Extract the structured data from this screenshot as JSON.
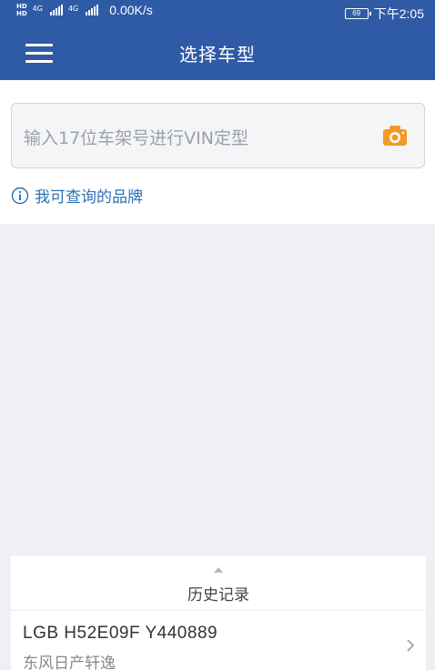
{
  "status": {
    "hd1": "HD",
    "hd2": "HD",
    "net1": "4G",
    "net2": "4G",
    "speed": "0.00K/s",
    "battery": "69",
    "time": "下午2:05"
  },
  "header": {
    "title": "选择车型",
    "menu_icon": "hamburger-menu-icon",
    "color": "#2f5aa6"
  },
  "search": {
    "placeholder": "输入17位车架号进行VIN定型",
    "camera_icon": "camera-icon",
    "camera_color": "#f39a26"
  },
  "brand_link": {
    "label": "我可查询的品牌",
    "icon": "info-icon",
    "color": "#2c72b8"
  },
  "history": {
    "title": "历史记录",
    "items": [
      {
        "vin": "LGB H52E09F Y440889",
        "model": "东风日产轩逸"
      }
    ]
  }
}
